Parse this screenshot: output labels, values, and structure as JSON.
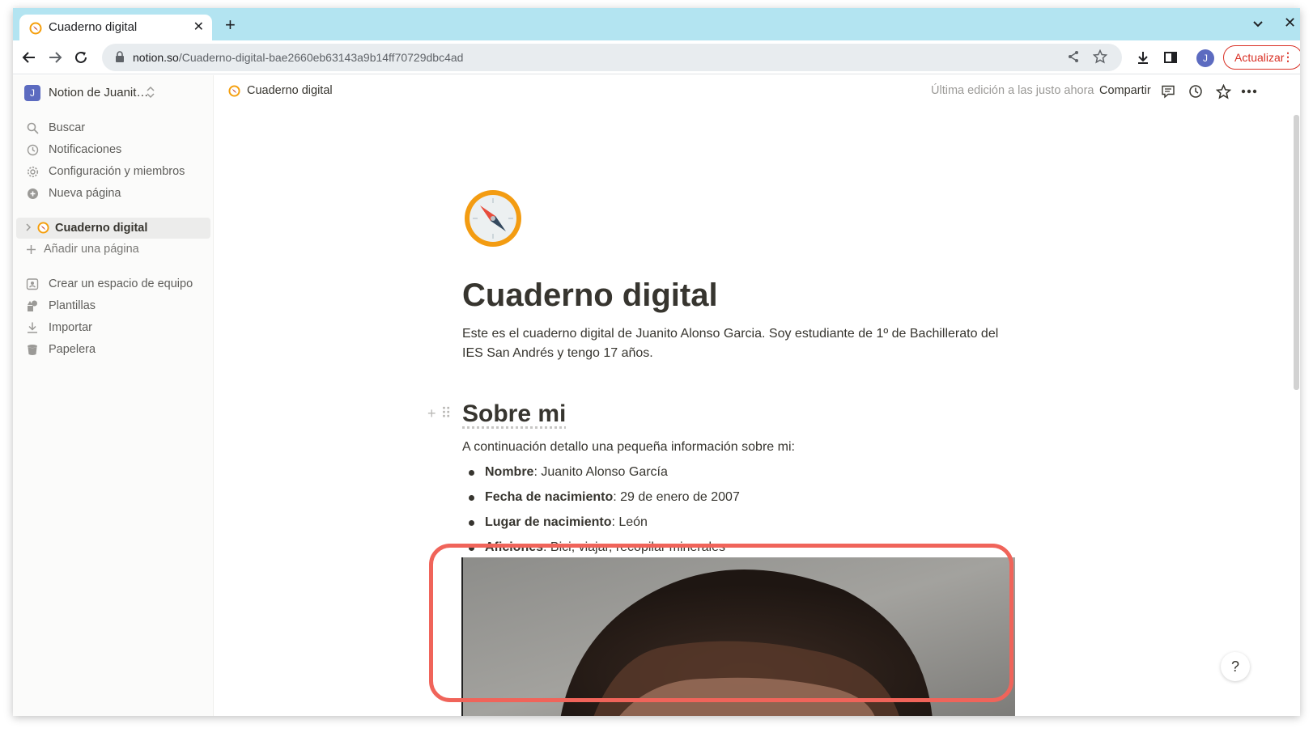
{
  "browser": {
    "tab_title": "Cuaderno digital",
    "url_host": "notion.so",
    "url_path": "/Cuaderno-digital-bae2660eb63143a9b14ff70729dbc4ad",
    "profile_initial": "J",
    "update_label": "Actualizar",
    "accent_color": "#d93025",
    "tabstrip_color": "#b3e4f1"
  },
  "sidebar": {
    "workspace_initial": "J",
    "workspace_name": "Notion de Juanit…",
    "items": [
      {
        "label": "Buscar",
        "icon": "search-icon"
      },
      {
        "label": "Notificaciones",
        "icon": "clock-icon"
      },
      {
        "label": "Configuración y miembros",
        "icon": "gear-icon"
      },
      {
        "label": "Nueva página",
        "icon": "plus-circle-icon"
      }
    ],
    "current_page": "Cuaderno digital",
    "add_page": "Añadir una página",
    "bottom_items": [
      {
        "label": "Crear un espacio de equipo",
        "icon": "teamspace-icon"
      },
      {
        "label": "Plantillas",
        "icon": "templates-icon"
      },
      {
        "label": "Importar",
        "icon": "import-icon"
      },
      {
        "label": "Papelera",
        "icon": "trash-icon"
      }
    ]
  },
  "topbar": {
    "breadcrumb": "Cuaderno digital",
    "last_edit": "Última edición a las justo ahora",
    "share": "Compartir"
  },
  "page": {
    "title": "Cuaderno digital",
    "intro": "Este es el cuaderno digital de Juanito Alonso Garcia. Soy estudiante de 1º de Bachillerato del IES San Andrés y tengo 17 años.",
    "section_title": "Sobre mi",
    "section_desc": "A continuación detallo una pequeña información sobre mi:",
    "bullets": [
      {
        "key": "Nombre",
        "value": ": Juanito Alonso García"
      },
      {
        "key": "Fecha de nacimiento",
        "value": ": 29 de enero de 2007"
      },
      {
        "key": "Lugar de nacimiento",
        "value": ": León"
      },
      {
        "key": "Aficiones",
        "value": ": Bici, viajar, recopilar minerales"
      }
    ],
    "help": "?"
  }
}
